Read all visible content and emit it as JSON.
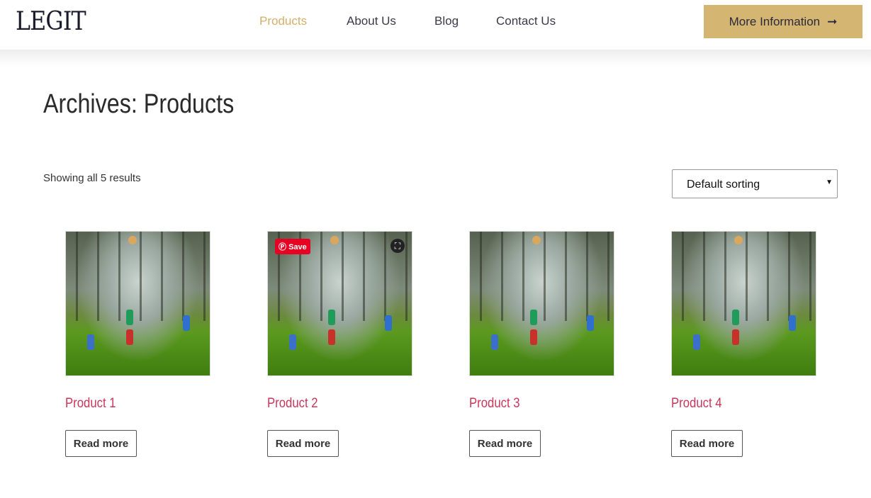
{
  "header": {
    "logo": "LEGIT",
    "nav": [
      {
        "label": "Products",
        "active": true
      },
      {
        "label": "About Us"
      },
      {
        "label": "Blog"
      },
      {
        "label": "Contact Us"
      }
    ],
    "cta": "More Information",
    "cta_icon": "arrow-right-icon",
    "accent": "#d4b572"
  },
  "page": {
    "title": "Archives: Products",
    "result_count": "Showing all 5 results",
    "sort": "Default sorting"
  },
  "products": [
    {
      "title": "Product 1",
      "button": "Read more"
    },
    {
      "title": "Product 2",
      "button": "Read more",
      "pin_save": "Save"
    },
    {
      "title": "Product 3",
      "button": "Read more"
    },
    {
      "title": "Product 4",
      "button": "Read more"
    }
  ]
}
